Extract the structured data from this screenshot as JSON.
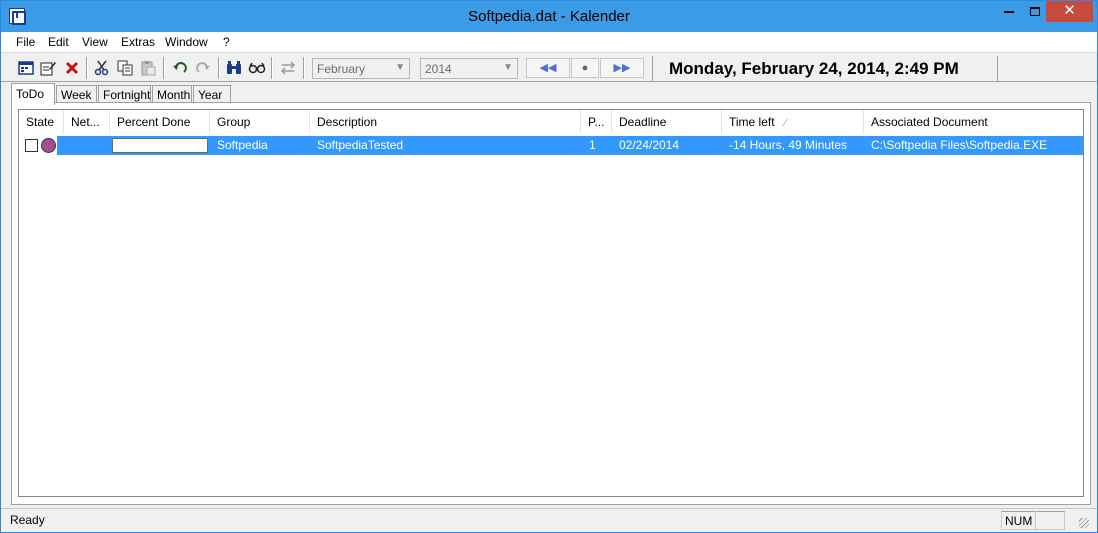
{
  "window": {
    "title": "Softpedia.dat - Kalender",
    "close_glyph": "✕"
  },
  "menu": {
    "items": [
      "File",
      "Edit",
      "View",
      "Extras",
      "Window",
      "?"
    ]
  },
  "toolbar": {
    "icons": [
      "new-entry-icon",
      "edit-icon",
      "delete-icon",
      "cut-icon",
      "copy-icon",
      "paste-icon",
      "undo-icon",
      "redo-icon",
      "find-icon",
      "find-next-icon",
      "swap-icon"
    ],
    "month": "February",
    "year": "2014",
    "nav_prev": "◀◀",
    "nav_today": "●",
    "nav_next": "▶▶",
    "datetime": "Monday, February 24, 2014, 2:49 PM"
  },
  "tabs": [
    {
      "label": "ToDo",
      "active": true
    },
    {
      "label": "Week",
      "active": false
    },
    {
      "label": "Fortnight",
      "active": false
    },
    {
      "label": "Month",
      "active": false
    },
    {
      "label": "Year",
      "active": false
    }
  ],
  "table": {
    "columns": [
      "State",
      "Net...",
      "Percent Done",
      "Group",
      "Description",
      "P...",
      "Deadline",
      "Time left",
      "Associated Document"
    ],
    "sorted_column": "Time left",
    "rows": [
      {
        "checked": false,
        "state_color": "#9d5092",
        "net": "",
        "percent_done": 0,
        "group": "Softpedia",
        "description": "SoftpediaTested",
        "priority": "1",
        "deadline": "02/24/2014",
        "time_left": "-14 Hours, 49 Minutes",
        "document": "C:\\Softpedia Files\\Softpedia.EXE",
        "selected": true
      }
    ]
  },
  "status": {
    "text": "Ready",
    "num": "NUM"
  },
  "colors": {
    "selection": "#3399ff",
    "title_bar": "#3c9be6",
    "close_button": "#c74a3c"
  }
}
